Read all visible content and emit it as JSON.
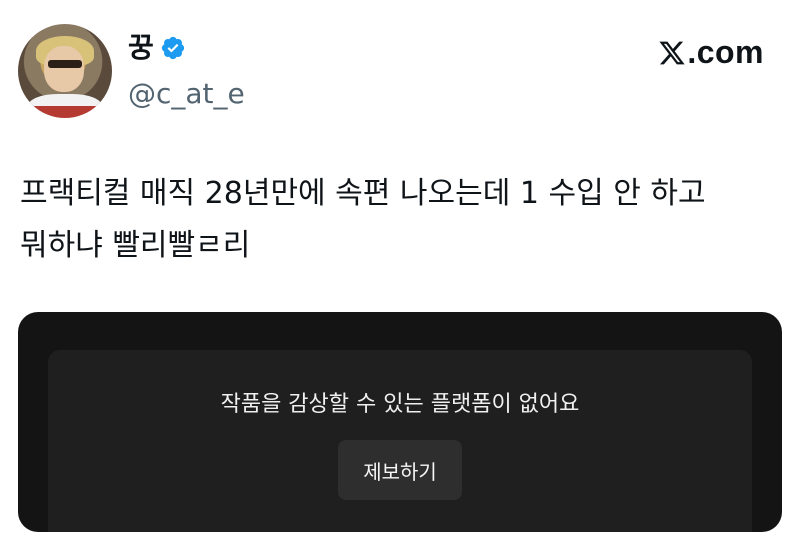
{
  "author": {
    "display_name": "꿍",
    "handle": "@c_at_e",
    "verified": true,
    "verified_color": "#1d9bf0"
  },
  "brand": {
    "text": ".com"
  },
  "tweet": {
    "text": "프랙티컬 매직 28년만에 속편 나오는데 1 수입 안 하고\n뭐하냐 빨리빨ㄹ리"
  },
  "media": {
    "message": "작품을 감상할 수 있는 플랫폼이 없어요",
    "report_label": "제보하기",
    "background": "#141414"
  }
}
